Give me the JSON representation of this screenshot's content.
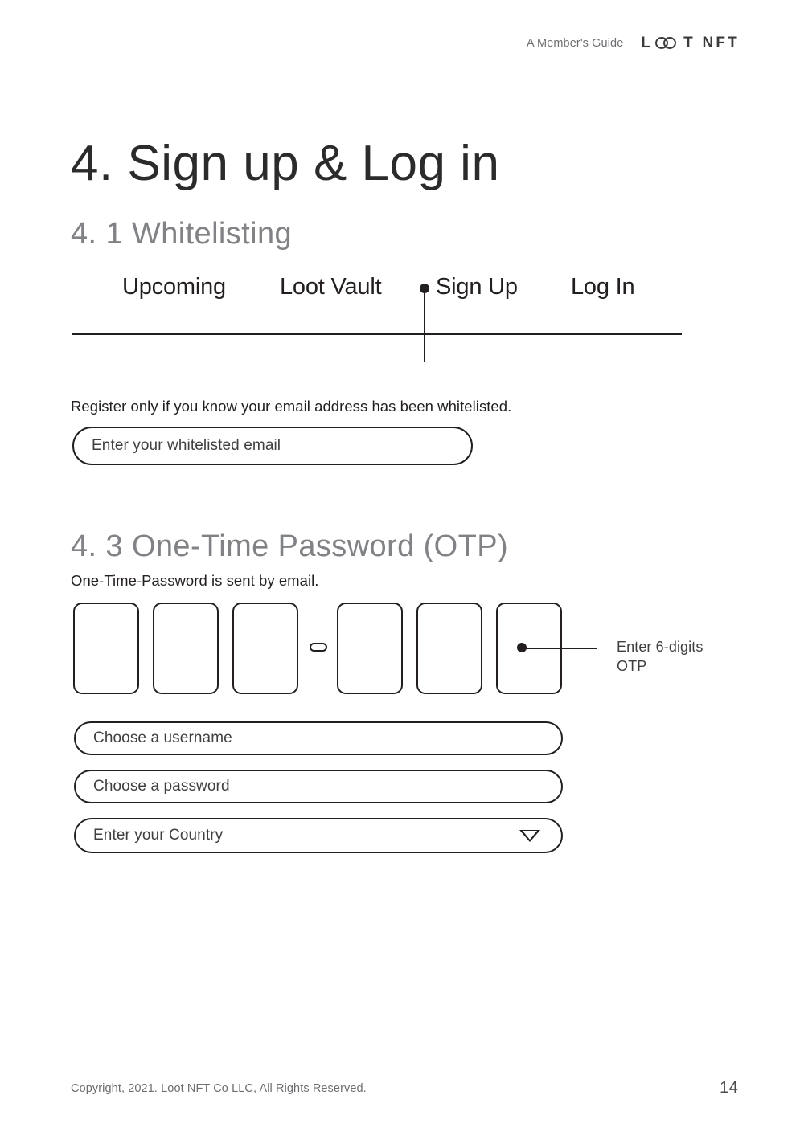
{
  "header": {
    "guide_label": "A Member's Guide",
    "brand": {
      "lead": "L",
      "rings_icon": "interlocking-circles-icon",
      "tail": "T NFT",
      "full_text": "LOOT NFT"
    }
  },
  "chapter": {
    "title": "4. Sign up & Log in"
  },
  "sections": {
    "whitelisting": {
      "title": "4. 1 Whitelisting",
      "description": "Register only if you know your email address has been whitelisted.",
      "email_input": {
        "placeholder": "Enter your whitelisted email",
        "value": ""
      }
    },
    "otp": {
      "title": "4. 3 One-Time Password (OTP)",
      "description": "One-Time-Password is sent by email.",
      "digit_count": 6,
      "separator": "-",
      "separator_after_index": 3,
      "digits": [
        "",
        "",
        "",
        "",
        "",
        ""
      ],
      "callout": "Enter 6-digits\nOTP",
      "username_input": {
        "placeholder": "Choose a username",
        "value": ""
      },
      "password_input": {
        "placeholder": "Choose a password",
        "value": ""
      },
      "country_input": {
        "placeholder": "Enter your Country",
        "value": "",
        "caret_icon": "chevron-down-icon"
      }
    }
  },
  "nav": {
    "tabs": [
      {
        "label": "Upcoming",
        "active": false
      },
      {
        "label": "Loot Vault",
        "active": false
      },
      {
        "label": "Sign Up",
        "active": true
      },
      {
        "label": "Log In",
        "active": false
      }
    ]
  },
  "footer": {
    "copyright": "Copyright, 2021. Loot NFT Co LLC, All Rights Reserved.",
    "page_number": "14"
  },
  "colors": {
    "ink": "#231f20",
    "muted": "#808285",
    "footer_text": "#6d6e71",
    "page_background": "#ffffff"
  }
}
